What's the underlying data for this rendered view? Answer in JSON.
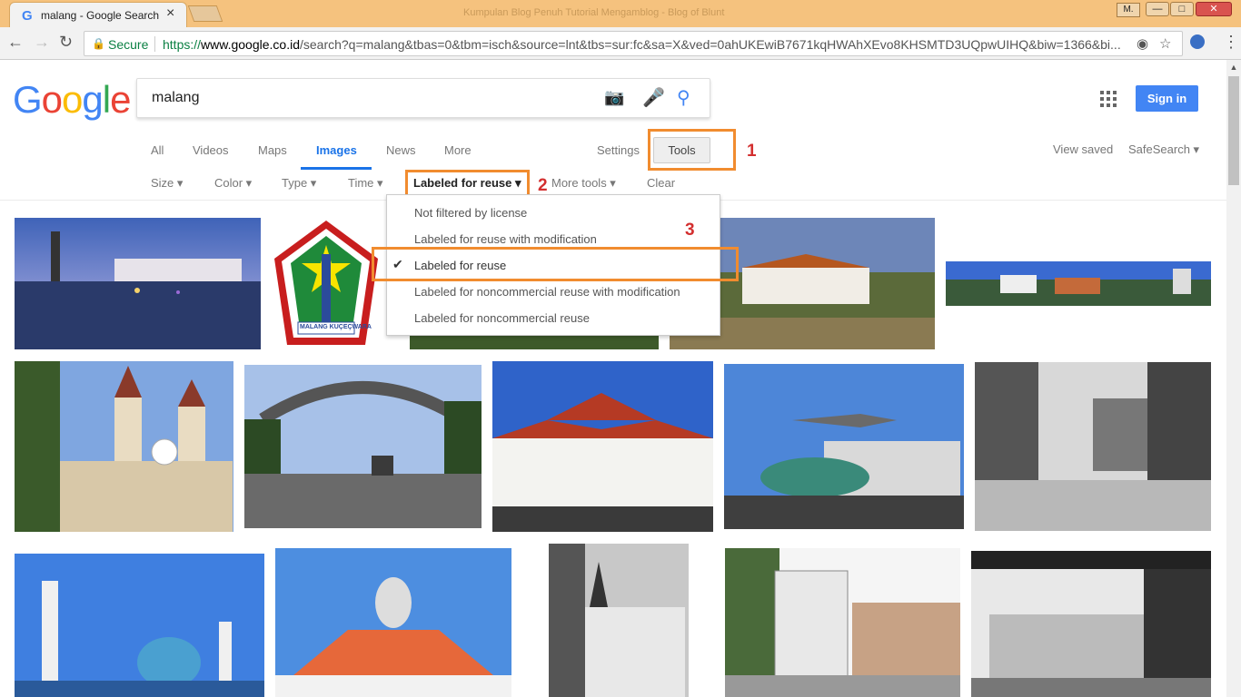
{
  "browser": {
    "tab_title": "malang - Google Search",
    "tab_close": "×",
    "faded_title": "Kumpulan Blog Penuh Tutorial Mengamblog - Blog of Blunt",
    "profile": "M.",
    "win_min": "—",
    "win_max": "□",
    "win_close": "✕",
    "secure_label": "Secure",
    "url_prefix": "https://",
    "url_host": "www.google.co.id",
    "url_rest": "/search?q=malang&tbas=0&tbm=isch&source=lnt&tbs=sur:fc&sa=X&ved=0ahUKEwiB7671kqHWAhXEvo8KHSMTD3UQpwUIHQ&biw=1366&bi..."
  },
  "header": {
    "logo": [
      "G",
      "o",
      "o",
      "g",
      "l",
      "e"
    ],
    "logo_colors": [
      "#4285f4",
      "#ea4335",
      "#fbbc05",
      "#4285f4",
      "#34a853",
      "#ea4335"
    ],
    "query": "malang",
    "sign_in": "Sign in"
  },
  "nav": {
    "tabs": [
      "All",
      "Videos",
      "Maps",
      "Images",
      "News",
      "More"
    ],
    "active": "Images",
    "settings": "Settings",
    "tools": "Tools",
    "view_saved": "View saved",
    "safesearch": "SafeSearch ▾"
  },
  "filters": {
    "size": "Size ▾",
    "color": "Color ▾",
    "type": "Type ▾",
    "time": "Time ▾",
    "usage": "Labeled for reuse ▾",
    "more_tools": "More tools ▾",
    "clear": "Clear"
  },
  "dropdown": {
    "items": [
      "Not filtered by license",
      "Labeled for reuse with modification",
      "Labeled for reuse",
      "Labeled for noncommercial reuse with modification",
      "Labeled for noncommercial reuse"
    ],
    "checked": "Labeled for reuse"
  },
  "annotations": [
    "1",
    "2",
    "3"
  ],
  "emblem_text": "MALANG KUÇEÇWARA"
}
